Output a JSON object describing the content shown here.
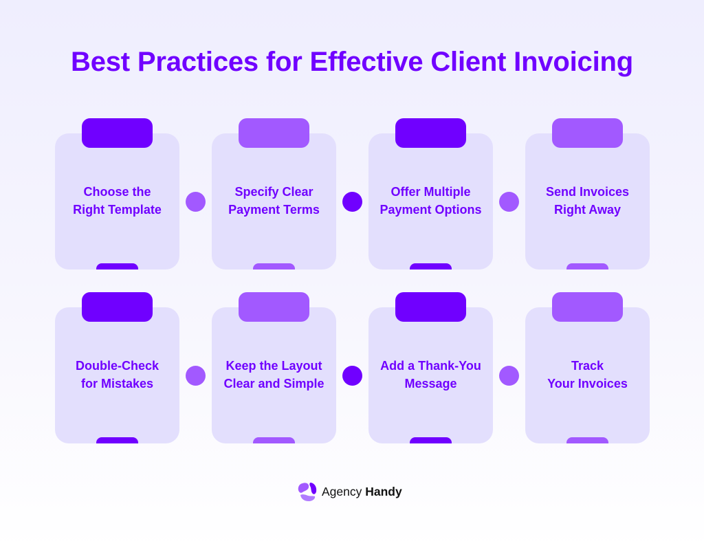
{
  "title": "Best Practices for Effective Client Invoicing",
  "colors": {
    "primary": "#7000FF",
    "secondary": "#A259FF",
    "card_bg": "#E3DFFD",
    "bg_top": "#EFEEFE",
    "bg_bottom": "#FFFFFF"
  },
  "rows": [
    {
      "cards": [
        {
          "label": "Choose the\nRight Template",
          "accent": "dark"
        },
        {
          "label": "Specify Clear\nPayment Terms",
          "accent": "light"
        },
        {
          "label": "Offer Multiple\nPayment Options",
          "accent": "dark"
        },
        {
          "label": "Send Invoices\nRight Away",
          "accent": "light"
        }
      ],
      "connectors": [
        "light",
        "dark",
        "light"
      ]
    },
    {
      "cards": [
        {
          "label": "Double-Check\nfor Mistakes",
          "accent": "dark"
        },
        {
          "label": "Keep the Layout\nClear and Simple",
          "accent": "light"
        },
        {
          "label": "Add a Thank-You\nMessage",
          "accent": "dark"
        },
        {
          "label": "Track\nYour Invoices",
          "accent": "light"
        }
      ],
      "connectors": [
        "light",
        "dark",
        "light"
      ]
    }
  ],
  "footer": {
    "logo_icon": "agency-handy-logo-icon",
    "brand_regular": "Agency",
    "brand_bold": "Handy"
  }
}
